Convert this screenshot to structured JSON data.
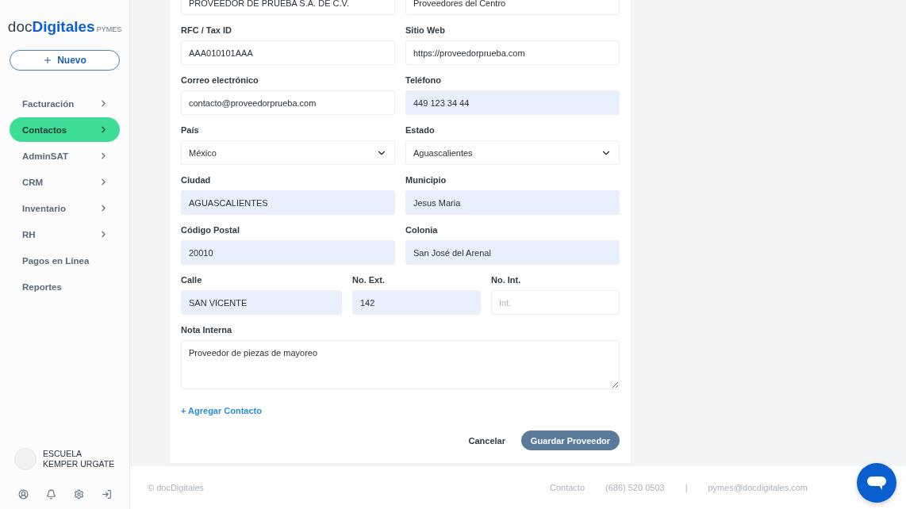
{
  "sidebar": {
    "logo": {
      "prefix": "doc",
      "name": "Digitales",
      "suffix": "PYMES"
    },
    "new_button": "Nuevo",
    "items": [
      {
        "label": "Facturación",
        "has_submenu": true,
        "selected": false
      },
      {
        "label": "Contactos",
        "has_submenu": true,
        "selected": true
      },
      {
        "label": "AdminSAT",
        "has_submenu": true,
        "selected": false
      },
      {
        "label": "CRM",
        "has_submenu": true,
        "selected": false
      },
      {
        "label": "Inventario",
        "has_submenu": true,
        "selected": false
      },
      {
        "label": "RH",
        "has_submenu": true,
        "selected": false
      },
      {
        "label": "Pagos en Línea",
        "has_submenu": false,
        "selected": false
      },
      {
        "label": "Reportes",
        "has_submenu": false,
        "selected": false
      }
    ],
    "company": "ESCUELA KEMPER URGATE"
  },
  "form": {
    "rows": [
      {
        "fields": [
          {
            "kind": "text",
            "value": "PROVEEDOR DE PRUEBA S.A. DE C.V.",
            "autofilled": false
          },
          {
            "kind": "text",
            "value": "Proveedores del Centro",
            "autofilled": false
          }
        ]
      },
      {
        "fields": [
          {
            "kind": "text",
            "label": "RFC / Tax ID",
            "value": "AAA010101AAA",
            "autofilled": false
          },
          {
            "kind": "text",
            "label": "Sitio Web",
            "value": "https://proveedorprueba.com",
            "autofilled": false
          }
        ]
      },
      {
        "fields": [
          {
            "kind": "text",
            "label": "Correo electrónico",
            "value": "contacto@proveedorprueba.com",
            "autofilled": false
          },
          {
            "kind": "text",
            "label": "Teléfono",
            "value": "449 123 34 44",
            "autofilled": true
          }
        ]
      },
      {
        "fields": [
          {
            "kind": "select",
            "label": "País",
            "value": "México",
            "autofilled": false
          },
          {
            "kind": "select",
            "label": "Estado",
            "value": "Aguascalientes",
            "autofilled": false
          }
        ]
      },
      {
        "fields": [
          {
            "kind": "text",
            "label": "Ciudad",
            "value": "AGUASCALIENTES",
            "autofilled": true
          },
          {
            "kind": "text",
            "label": "Municipio",
            "value": "Jesus Maria",
            "autofilled": true
          }
        ]
      },
      {
        "fields": [
          {
            "kind": "text",
            "label": "Código Postal",
            "value": "20010",
            "autofilled": true
          },
          {
            "kind": "text",
            "label": "Colonia",
            "value": "San José del Arenal",
            "autofilled": true
          }
        ]
      },
      {
        "fields": [
          {
            "kind": "text",
            "label": "Calle",
            "value": "SAN VICENTE",
            "autofilled": true
          },
          {
            "kind": "text",
            "label": "No. Ext.",
            "value": "142",
            "autofilled": true
          },
          {
            "kind": "text",
            "label": "No. Int.",
            "placeholder": "Int.",
            "autofilled": false
          }
        ]
      },
      {
        "fields": [
          {
            "kind": "textarea",
            "label": "Nota Interna",
            "value": "Proveedor de piezas de mayoreo",
            "autofilled": false
          }
        ]
      }
    ],
    "add_contact": "+ Agregar Contacto",
    "cancel": "Cancelar",
    "save": "Guardar Proveedor"
  },
  "footer": {
    "copyright": "© docDigitales",
    "contact_label": "Contacto",
    "phone": "(686) 520 0503",
    "separator": "|",
    "email": "pymes@docdigitales.com"
  }
}
